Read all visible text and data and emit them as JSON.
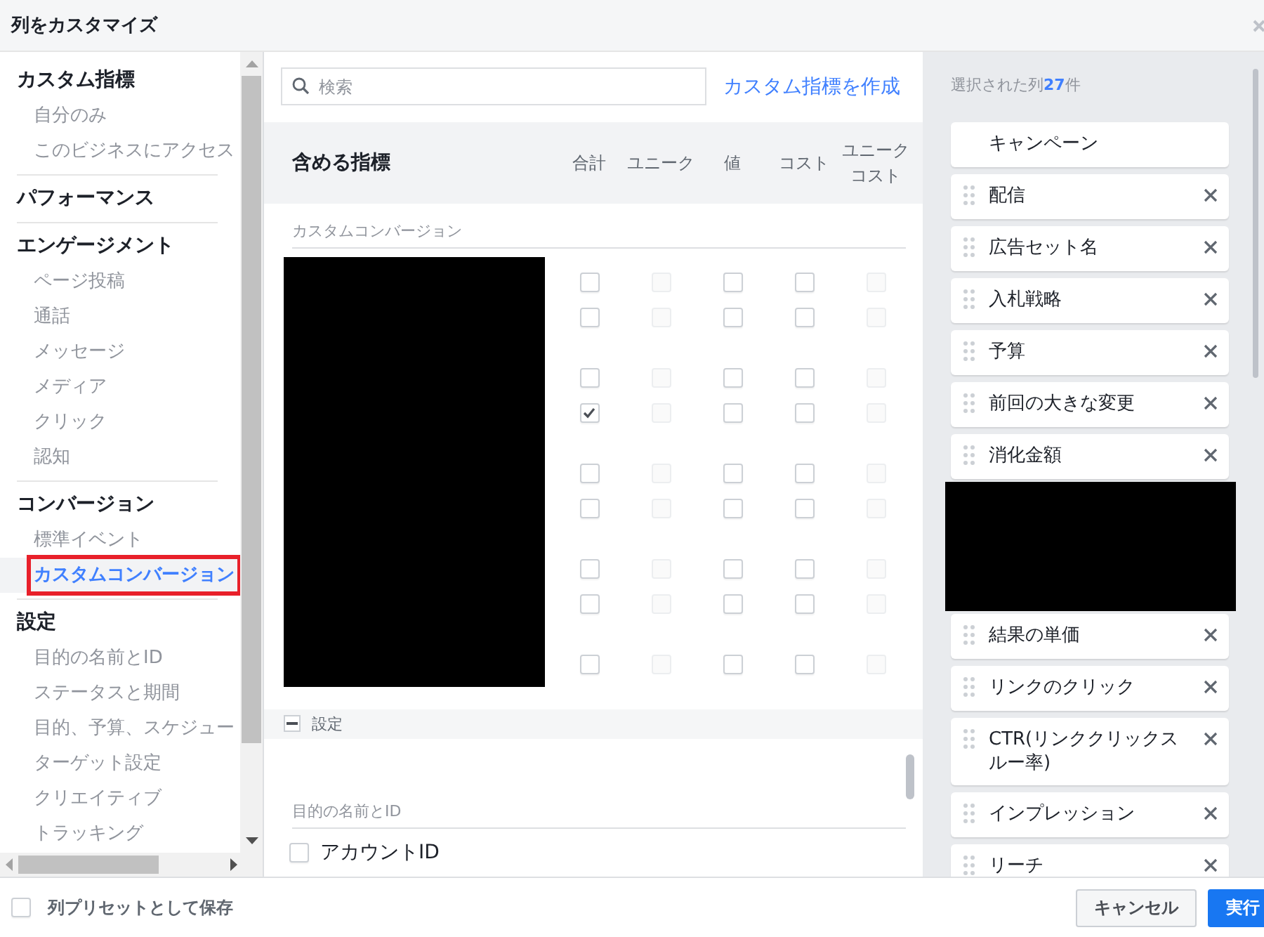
{
  "window": {
    "title": "列をカスタマイズ"
  },
  "sidebar": {
    "sections": [
      {
        "heading": "カスタム指標",
        "items": [
          {
            "label": "自分のみ",
            "selected": false,
            "highlighted": false
          },
          {
            "label": "このビジネスにアクセス",
            "selected": false,
            "highlighted": false
          }
        ]
      },
      {
        "heading": "パフォーマンス"
      },
      {
        "heading": "エンゲージメント",
        "items": [
          {
            "label": "ページ投稿",
            "selected": false,
            "highlighted": false
          },
          {
            "label": "通話",
            "selected": false,
            "highlighted": false
          },
          {
            "label": "メッセージ",
            "selected": false,
            "highlighted": false
          },
          {
            "label": "メディア",
            "selected": false,
            "highlighted": false
          },
          {
            "label": "クリック",
            "selected": false,
            "highlighted": false
          },
          {
            "label": "認知",
            "selected": false,
            "highlighted": false
          }
        ]
      },
      {
        "heading": "コンバージョン",
        "items": [
          {
            "label": "標準イベント",
            "selected": false,
            "highlighted": false
          },
          {
            "label": "カスタムコンバージョン",
            "selected": true,
            "highlighted": true
          }
        ]
      },
      {
        "heading": "設定",
        "items": [
          {
            "label": "目的の名前とID",
            "selected": false,
            "highlighted": false
          },
          {
            "label": "ステータスと期間",
            "selected": false,
            "highlighted": false
          },
          {
            "label": "目的、予算、スケジュー",
            "selected": false,
            "highlighted": false
          },
          {
            "label": "ターゲット設定",
            "selected": false,
            "highlighted": false
          },
          {
            "label": "クリエイティブ",
            "selected": false,
            "highlighted": false
          },
          {
            "label": "トラッキング",
            "selected": false,
            "highlighted": false
          }
        ]
      }
    ]
  },
  "search": {
    "placeholder": "検索"
  },
  "create_link": "カスタム指標を作成",
  "metrics_header": {
    "title": "含める指標",
    "columns": [
      "合計",
      "ユニーク",
      "値",
      "コスト",
      "ユニークコスト"
    ]
  },
  "custom_conversions": {
    "caption": "カスタムコンバージョン",
    "groups": [
      [
        {
          "cells": [
            {
              "checked": false,
              "disabled": false
            },
            {
              "checked": false,
              "disabled": true
            },
            {
              "checked": false,
              "disabled": false
            },
            {
              "checked": false,
              "disabled": false
            },
            {
              "checked": false,
              "disabled": true
            }
          ]
        },
        {
          "cells": [
            {
              "checked": false,
              "disabled": false
            },
            {
              "checked": false,
              "disabled": true
            },
            {
              "checked": false,
              "disabled": false
            },
            {
              "checked": false,
              "disabled": false
            },
            {
              "checked": false,
              "disabled": true
            }
          ]
        }
      ],
      [
        {
          "cells": [
            {
              "checked": false,
              "disabled": false
            },
            {
              "checked": false,
              "disabled": true
            },
            {
              "checked": false,
              "disabled": false
            },
            {
              "checked": false,
              "disabled": false
            },
            {
              "checked": false,
              "disabled": true
            }
          ]
        },
        {
          "cells": [
            {
              "checked": true,
              "disabled": false
            },
            {
              "checked": false,
              "disabled": true
            },
            {
              "checked": false,
              "disabled": false
            },
            {
              "checked": false,
              "disabled": false
            },
            {
              "checked": false,
              "disabled": true
            }
          ]
        }
      ],
      [
        {
          "cells": [
            {
              "checked": false,
              "disabled": false
            },
            {
              "checked": false,
              "disabled": true
            },
            {
              "checked": false,
              "disabled": false
            },
            {
              "checked": false,
              "disabled": false
            },
            {
              "checked": false,
              "disabled": true
            }
          ]
        },
        {
          "cells": [
            {
              "checked": false,
              "disabled": false
            },
            {
              "checked": false,
              "disabled": true
            },
            {
              "checked": false,
              "disabled": false
            },
            {
              "checked": false,
              "disabled": false
            },
            {
              "checked": false,
              "disabled": true
            }
          ]
        }
      ],
      [
        {
          "cells": [
            {
              "checked": false,
              "disabled": false
            },
            {
              "checked": false,
              "disabled": true
            },
            {
              "checked": false,
              "disabled": false
            },
            {
              "checked": false,
              "disabled": false
            },
            {
              "checked": false,
              "disabled": true
            }
          ]
        },
        {
          "cells": [
            {
              "checked": false,
              "disabled": false
            },
            {
              "checked": false,
              "disabled": true
            },
            {
              "checked": false,
              "disabled": false
            },
            {
              "checked": false,
              "disabled": false
            },
            {
              "checked": false,
              "disabled": true
            }
          ]
        }
      ],
      [
        {
          "cells": [
            {
              "checked": false,
              "disabled": false
            },
            {
              "checked": false,
              "disabled": true
            },
            {
              "checked": false,
              "disabled": false
            },
            {
              "checked": false,
              "disabled": false
            },
            {
              "checked": false,
              "disabled": true
            }
          ]
        }
      ]
    ]
  },
  "settings_section": {
    "title": "設定",
    "expanded": true,
    "caption": "目的の名前とID",
    "items": [
      {
        "label": "アカウントID",
        "checked": false
      }
    ]
  },
  "selected_columns": {
    "label": "選択された列",
    "count": "27",
    "unit": "件",
    "items": [
      {
        "kind": "fixed",
        "label": "キャンペーン"
      },
      {
        "kind": "removable",
        "label": "配信"
      },
      {
        "kind": "removable",
        "label": "広告セット名"
      },
      {
        "kind": "removable",
        "label": "入札戦略"
      },
      {
        "kind": "removable",
        "label": "予算"
      },
      {
        "kind": "removable",
        "label": "前回の大きな変更"
      },
      {
        "kind": "removable",
        "label": "消化金額"
      },
      {
        "kind": "redacted"
      },
      {
        "kind": "removable",
        "label": "結果の単価"
      },
      {
        "kind": "removable",
        "label": "リンクのクリック"
      },
      {
        "kind": "removable",
        "label": "CTR(リンククリックスルー率)"
      },
      {
        "kind": "removable",
        "label": "インプレッション"
      },
      {
        "kind": "removable",
        "label": "リーチ"
      }
    ]
  },
  "footer": {
    "save_preset": {
      "label": "列プリセットとして保存",
      "checked": false
    },
    "buttons": [
      {
        "label": "キャンセル",
        "kind": "secondary"
      },
      {
        "label": "実行",
        "kind": "primary"
      }
    ]
  }
}
